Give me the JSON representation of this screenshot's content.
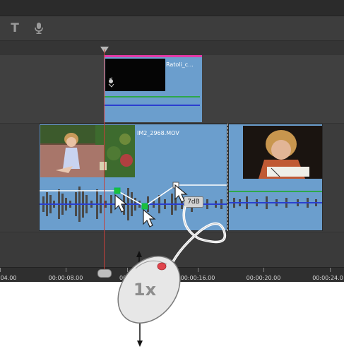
{
  "toolbar": {
    "text_tool_icon": "text-tool-icon",
    "text_tool_glyph": "T",
    "mic_icon": "microphone-icon"
  },
  "clips": {
    "upper_clip_label": "Ratoli_c...",
    "main_clip_label": "IM2_2968.MOV"
  },
  "volume_tooltip": "7dB",
  "ruler": {
    "labels": [
      "04.00",
      "00:00:08.00",
      "00:0",
      "00:00:16.00",
      "00:00:20.00",
      "00:00:24.0"
    ]
  },
  "mouse_badge": "1x",
  "colors": {
    "clip_blue": "#6b9ecd",
    "playhead_red": "#c2403b",
    "clip_marker_pink": "#e23aa8",
    "volume_line_green": "#2ea84a",
    "audio_line_blue": "#2b3fd0",
    "keyframe_green": "#1fbf3a",
    "mouse_button_red": "#e0444c"
  }
}
